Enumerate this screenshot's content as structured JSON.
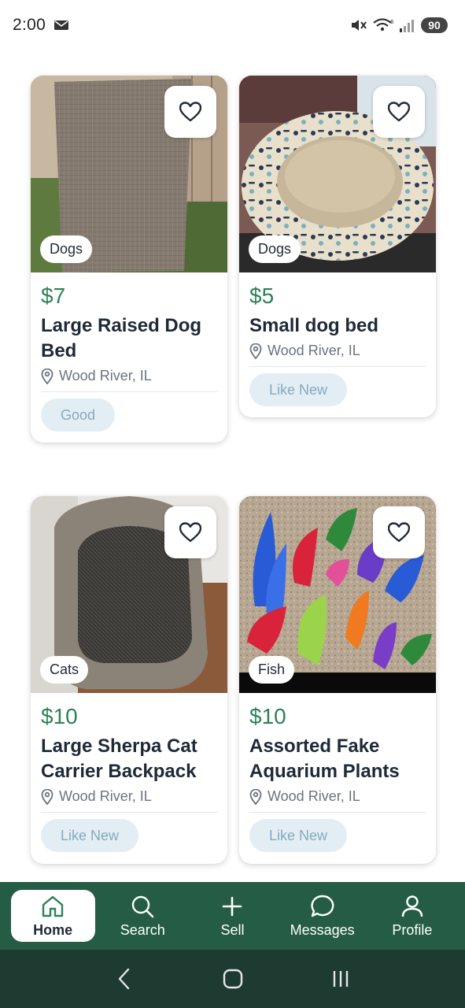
{
  "status_bar": {
    "time": "2:00",
    "battery": "90"
  },
  "listings": [
    {
      "price": "$7",
      "title": "Large Raised Dog Bed",
      "category": "Dogs",
      "location": "Wood River, IL",
      "condition": "Good",
      "favorited": false
    },
    {
      "price": "$5",
      "title": "Small dog bed",
      "category": "Dogs",
      "location": "Wood River, IL",
      "condition": "Like New",
      "favorited": false
    },
    {
      "price": "$10",
      "title": "Large Sherpa Cat Carrier Backpack",
      "category": "Cats",
      "location": "Wood River, IL",
      "condition": "Like New",
      "favorited": false
    },
    {
      "price": "$10",
      "title": "Assorted Fake Aquarium Plants",
      "category": "Fish",
      "location": "Wood River, IL",
      "condition": "Like New",
      "favorited": false
    }
  ],
  "bottom_nav": {
    "items": [
      {
        "label": "Home",
        "icon": "home-icon",
        "active": true
      },
      {
        "label": "Search",
        "icon": "search-icon",
        "active": false
      },
      {
        "label": "Sell",
        "icon": "plus-icon",
        "active": false
      },
      {
        "label": "Messages",
        "icon": "chat-bubble-icon",
        "active": false
      },
      {
        "label": "Profile",
        "icon": "user-icon",
        "active": false
      }
    ]
  },
  "colors": {
    "accent_green": "#2f8157",
    "nav_green": "#245c45",
    "system_nav": "#1d3b31",
    "condition_badge_bg": "#e3eef4",
    "condition_badge_text": "#86a9bd"
  }
}
